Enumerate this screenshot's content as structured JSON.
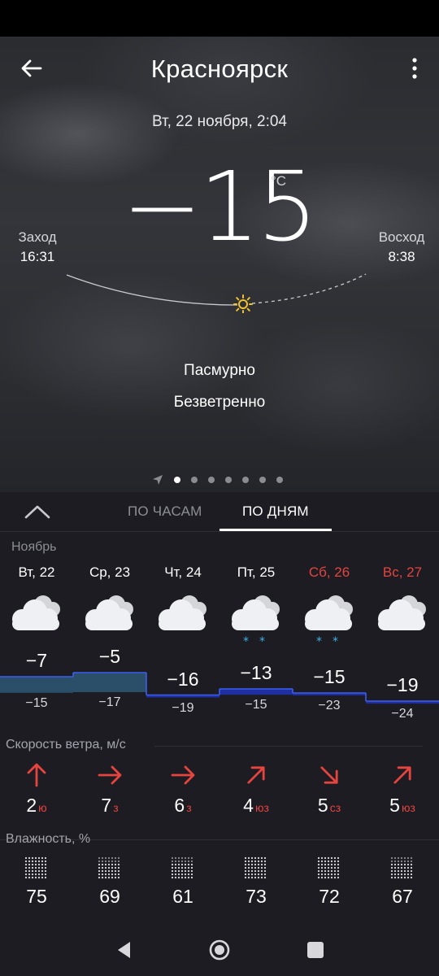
{
  "header": {
    "city": "Красноярск",
    "datetime": "Вт, 22 ноября, 2:04"
  },
  "current": {
    "temperature": "−15",
    "unit": "°C",
    "condition": "Пасмурно",
    "wind": "Безветренно"
  },
  "sun": {
    "sunset_label": "Заход",
    "sunset_time": "16:31",
    "sunrise_label": "Восход",
    "sunrise_time": "8:38"
  },
  "pager": {
    "count": 7,
    "active_index": 0,
    "first_icon": "location-arrow-icon"
  },
  "tabs": {
    "hours": "ПО ЧАСАМ",
    "days": "ПО ДНЯМ",
    "active": "days"
  },
  "month": "Ноябрь",
  "days": [
    {
      "label": "Вт, 22",
      "weekend": false,
      "icon": "cloudy-icon",
      "snow": false,
      "max": "−7",
      "min": "−15",
      "wind_speed": "2",
      "wind_dir": "ю",
      "humidity": "75"
    },
    {
      "label": "Ср, 23",
      "weekend": false,
      "icon": "cloudy-icon",
      "snow": false,
      "max": "−5",
      "min": "−17",
      "wind_speed": "7",
      "wind_dir": "з",
      "humidity": "69"
    },
    {
      "label": "Чт, 24",
      "weekend": false,
      "icon": "cloudy-icon",
      "snow": false,
      "max": "−16",
      "min": "−19",
      "wind_speed": "6",
      "wind_dir": "з",
      "humidity": "61"
    },
    {
      "label": "Пт, 25",
      "weekend": false,
      "icon": "cloudy-snow-icon",
      "snow": true,
      "max": "−13",
      "min": "−15",
      "wind_speed": "4",
      "wind_dir": "юз",
      "humidity": "73"
    },
    {
      "label": "Сб, 26",
      "weekend": true,
      "icon": "cloudy-snow-icon",
      "snow": true,
      "max": "−15",
      "min": "−23",
      "wind_speed": "5",
      "wind_dir": "сз",
      "humidity": "72"
    },
    {
      "label": "Вс, 27",
      "weekend": true,
      "icon": "cloudy-icon",
      "snow": false,
      "max": "−19",
      "min": "−24",
      "wind_speed": "5",
      "wind_dir": "юз",
      "humidity": "67"
    }
  ],
  "sections": {
    "wind_title": "Скорость ветра, м/с",
    "humidity_title": "Влажность, %"
  },
  "colors": {
    "weekend": "#e5443f",
    "wind_arrow": "#e5443f",
    "snowflake": "#3db3e8",
    "sun": "#f2c230",
    "temp_band_warm": "#2b4f68",
    "temp_band_cold": "#1f2fa0",
    "temp_band_line": "#3b5ef0"
  }
}
